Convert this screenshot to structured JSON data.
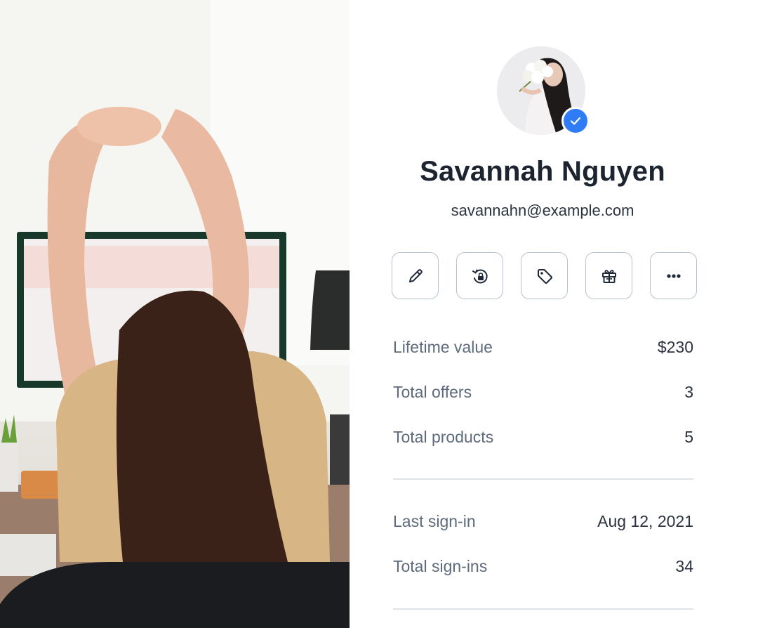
{
  "profile": {
    "name": "Savannah Nguyen",
    "email": "savannahn@example.com",
    "verified": true
  },
  "actions": [
    {
      "id": "edit",
      "icon": "pencil-icon"
    },
    {
      "id": "reset-password",
      "icon": "lock-reset-icon"
    },
    {
      "id": "tag",
      "icon": "tag-icon"
    },
    {
      "id": "gift",
      "icon": "gift-icon"
    },
    {
      "id": "more",
      "icon": "more-horizontal-icon"
    }
  ],
  "stats": [
    {
      "label": "Lifetime value",
      "value": "$230"
    },
    {
      "label": "Total offers",
      "value": "3"
    },
    {
      "label": "Total products",
      "value": "5"
    }
  ],
  "activity": [
    {
      "label": "Last sign-in",
      "value": "Aug 12, 2021"
    },
    {
      "label": "Total sign-ins",
      "value": "34"
    }
  ],
  "colors": {
    "accent": "#2f7cf6",
    "label": "#5d6b7c",
    "text": "#1c2430",
    "border": "#b9c3cf"
  }
}
